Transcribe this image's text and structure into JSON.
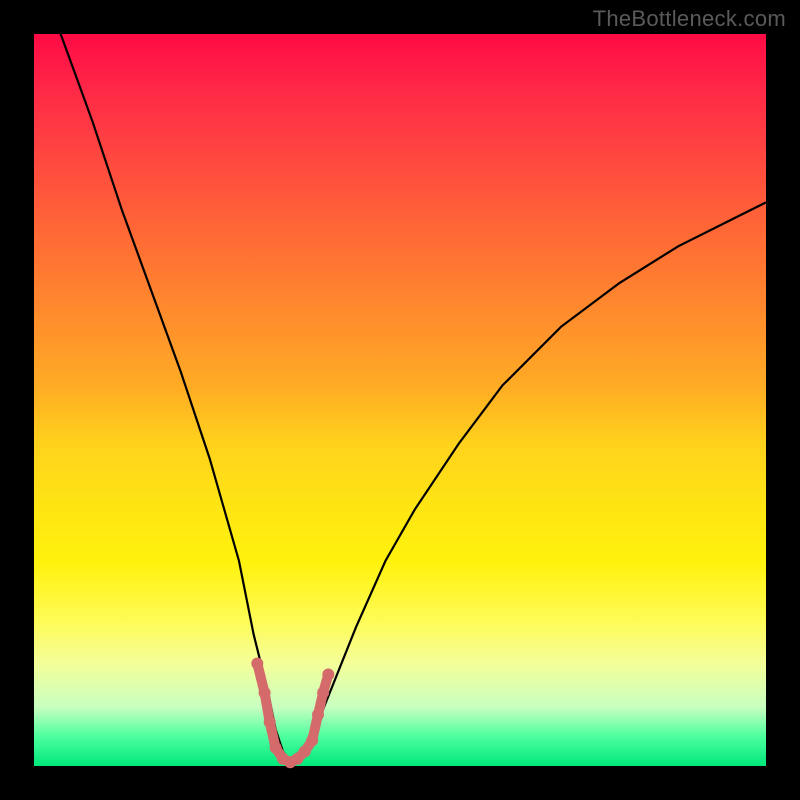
{
  "watermark": "TheBottleneck.com",
  "chart_data": {
    "type": "line",
    "title": "",
    "xlabel": "",
    "ylabel": "",
    "xlim": [
      0,
      100
    ],
    "ylim": [
      0,
      100
    ],
    "series": [
      {
        "name": "bottleneck-curve",
        "x": [
          0,
          4,
          8,
          12,
          16,
          20,
          24,
          28,
          30,
          32,
          33,
          34,
          35,
          36,
          37,
          38,
          40,
          44,
          48,
          52,
          58,
          64,
          72,
          80,
          88,
          96,
          100
        ],
        "y": [
          110,
          99,
          88,
          76,
          65,
          54,
          42,
          28,
          18,
          10,
          5,
          2,
          0.5,
          0.5,
          2,
          4,
          9,
          19,
          28,
          35,
          44,
          52,
          60,
          66,
          71,
          75,
          77
        ]
      }
    ],
    "markers": {
      "name": "highlight-dots",
      "color": "#d46a6a",
      "points": [
        {
          "x": 30.5,
          "y": 14
        },
        {
          "x": 31.5,
          "y": 10
        },
        {
          "x": 32.2,
          "y": 6
        },
        {
          "x": 33.0,
          "y": 2.5
        },
        {
          "x": 34.0,
          "y": 1
        },
        {
          "x": 35.0,
          "y": 0.5
        },
        {
          "x": 36.0,
          "y": 1
        },
        {
          "x": 37.0,
          "y": 2
        },
        {
          "x": 38.0,
          "y": 3.5
        },
        {
          "x": 38.8,
          "y": 7
        },
        {
          "x": 39.5,
          "y": 10
        },
        {
          "x": 40.2,
          "y": 12.5
        }
      ]
    },
    "gradient_stops": [
      {
        "pos": 0,
        "color": "#ff0a45"
      },
      {
        "pos": 50,
        "color": "#ffd21c"
      },
      {
        "pos": 100,
        "color": "#00e87a"
      }
    ]
  }
}
